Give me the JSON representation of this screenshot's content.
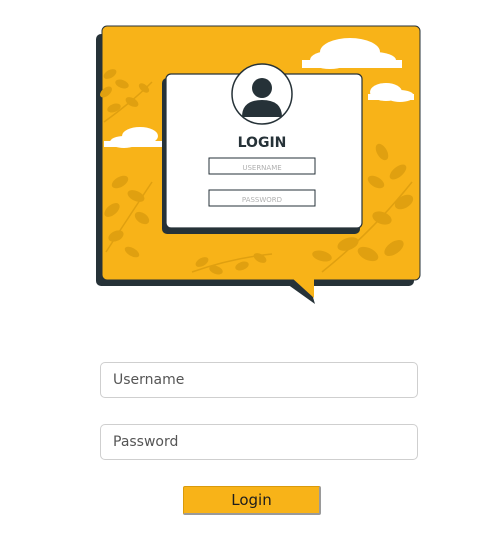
{
  "illustration": {
    "card_title": "LOGIN",
    "username_label": "USERNAME",
    "password_label": "PASSWORD",
    "colors": {
      "accent": "#f8b318",
      "dark": "#263238",
      "leaf": "#e0a010"
    }
  },
  "form": {
    "username_placeholder": "Username",
    "password_placeholder": "Password",
    "login_label": "Login"
  }
}
